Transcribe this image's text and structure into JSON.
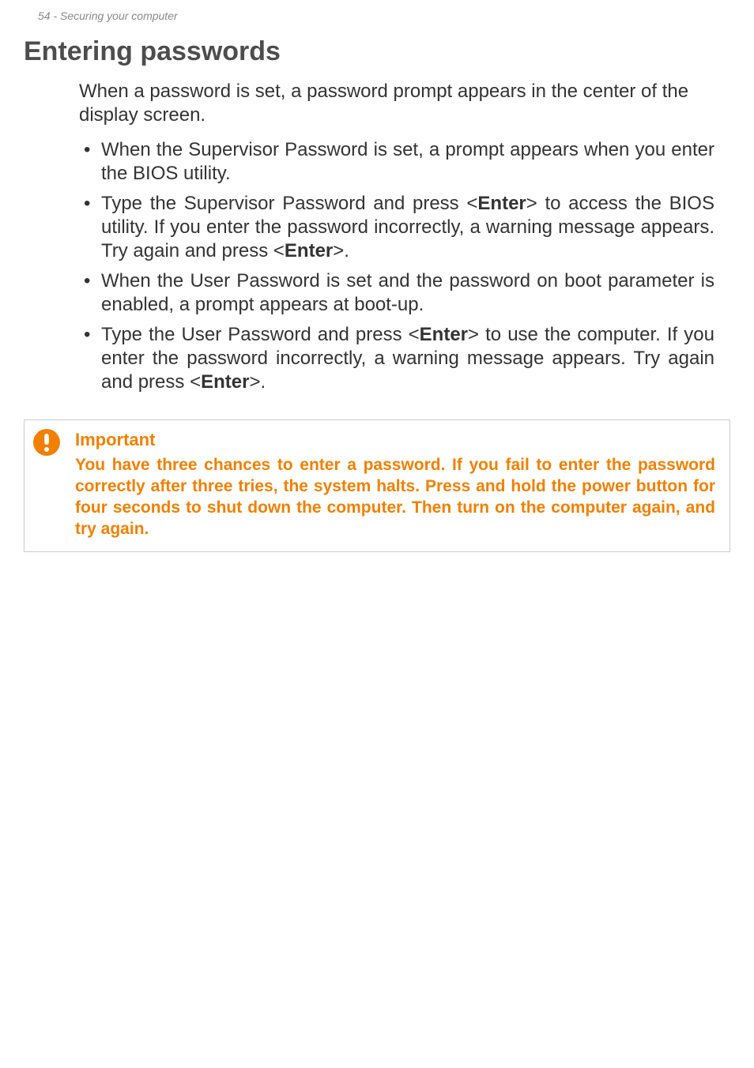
{
  "header": {
    "text": "54 - Securing your computer"
  },
  "heading": "Entering passwords",
  "intro": "When a password is set, a password prompt appears in the center of the display screen.",
  "bullets": [
    {
      "pre": "When the Supervisor Password is set, a prompt appears when you enter the BIOS utility."
    },
    {
      "pre": "Type the Supervisor Password and press <",
      "k1": "Enter",
      "mid": "> to access the BIOS utility. If you enter the password incorrectly, a warning message appears. Try again and press <",
      "k2": "Enter",
      "post": ">."
    },
    {
      "pre": "When the User Password is set and the password on boot parameter is enabled, a prompt appears at boot-up."
    },
    {
      "pre": "Type the User Password and press <",
      "k1": "Enter",
      "mid": "> to use the computer. If you enter the password incorrectly, a warning message appears. Try again and press <",
      "k2": "Enter",
      "post": ">."
    }
  ],
  "callout": {
    "title": "Important",
    "body": "You have three chances to enter a password. If you fail to enter the password correctly after three tries, the system halts. Press and hold the power button for four seconds to shut down the computer. Then turn on the computer again, and try again.",
    "icon_color": "#f08000"
  }
}
